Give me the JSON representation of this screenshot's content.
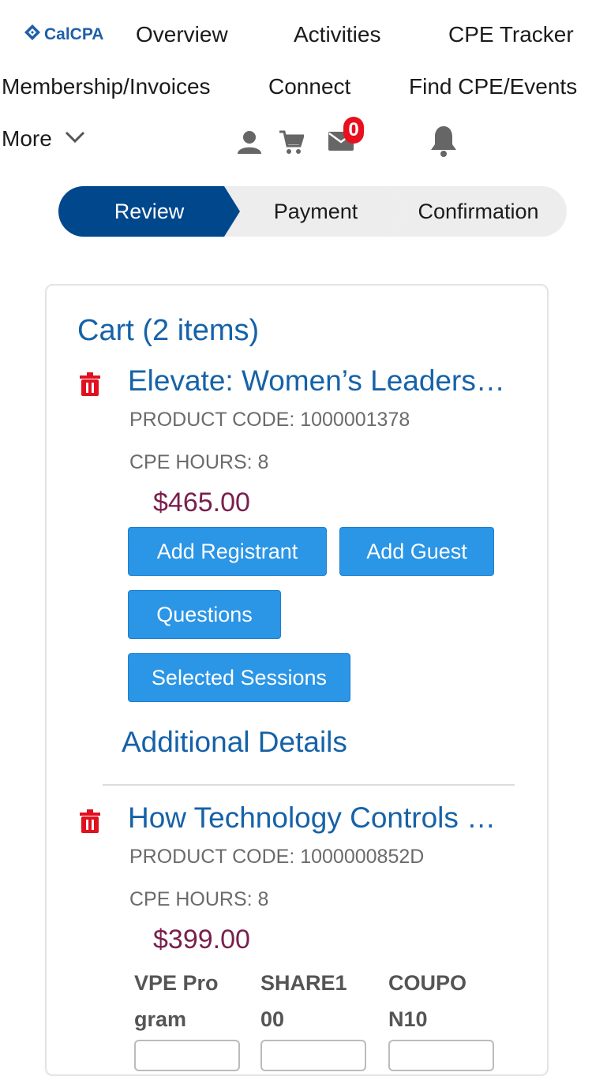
{
  "header": {
    "logo_text": "CalCPA",
    "nav": {
      "overview": "Overview",
      "activities": "Activities",
      "cpe_tracker": "CPE Tracker",
      "membership": "Membership/Invoices",
      "connect": "Connect",
      "find_cpe": "Find CPE/Events",
      "more": "More"
    },
    "icons": [
      "user-icon",
      "cart-icon",
      "mail-icon",
      "bell-icon",
      "chevron-down-icon"
    ],
    "mail_count": "0"
  },
  "steps": {
    "review": "Review",
    "payment": "Payment",
    "confirmation": "Confirmation",
    "active": "Review",
    "active_color": "#00478c"
  },
  "cart": {
    "title": "Cart (2 items)",
    "items": [
      {
        "title": "Elevate: Women’s Leadership",
        "product_code": "PRODUCT CODE: 1000001378",
        "cpe_hours": "CPE HOURS: 8",
        "price": "$465.00",
        "buttons": {
          "add_registrant": "Add Registrant",
          "add_guest": "Add Guest",
          "questions": "Questions",
          "selected_sessions": "Selected Sessions"
        },
        "additional_details": "Additional Details"
      },
      {
        "title": "How Technology Controls Everything",
        "product_code": "PRODUCT CODE: 1000000852D",
        "cpe_hours": "CPE HOURS: 8",
        "price": "$399.00",
        "codes": [
          "VPE Program",
          "SHARE100",
          "COUPON10"
        ]
      }
    ]
  },
  "colors": {
    "accent": "#2b95e6",
    "link": "#1662a8",
    "price": "#7a1f4d",
    "badge": "#e8101e",
    "trash": "#e0101e"
  }
}
